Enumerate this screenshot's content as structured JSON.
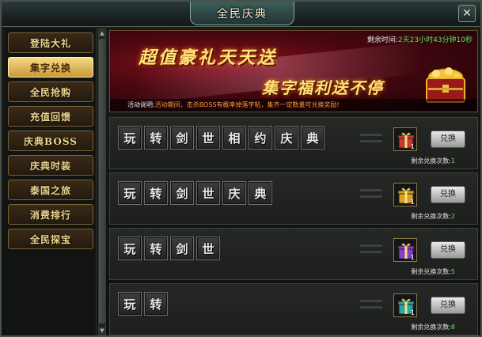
{
  "window": {
    "title": "全民庆典",
    "close_label": "✕"
  },
  "sidebar": {
    "items": [
      {
        "label": "登陆大礼",
        "active": false
      },
      {
        "label": "集字兑换",
        "active": true
      },
      {
        "label": "全民抢购",
        "active": false
      },
      {
        "label": "充值回馈",
        "active": false
      },
      {
        "label": "庆典BOSS",
        "active": false
      },
      {
        "label": "庆典时装",
        "active": false
      },
      {
        "label": "泰国之旅",
        "active": false
      },
      {
        "label": "消费排行",
        "active": false
      },
      {
        "label": "全民探宝",
        "active": false
      }
    ]
  },
  "banner": {
    "headline": "超值豪礼天天送",
    "subheadline": "集字福利送不停",
    "timer_label": "剩余时间:",
    "timer_value": "2天23小时43分钟10秒",
    "desc_label": "活动说明:",
    "desc_text": "活动期间，击杀BOSS有概率掉落字帖，集齐一定数量可兑换奖励!"
  },
  "rows": [
    {
      "chars": [
        "玩",
        "转",
        "剑",
        "世",
        "相",
        "约",
        "庆",
        "典"
      ],
      "reward_count": "1",
      "reward_color": "#c63a2a",
      "button": "兑换",
      "remain_label": "剩余兑换次数:",
      "remain": "1"
    },
    {
      "chars": [
        "玩",
        "转",
        "剑",
        "世",
        "庆",
        "典"
      ],
      "reward_count": "1",
      "reward_color": "#d8a11e",
      "button": "兑换",
      "remain_label": "剩余兑换次数:",
      "remain": "2"
    },
    {
      "chars": [
        "玩",
        "转",
        "剑",
        "世"
      ],
      "reward_count": "1",
      "reward_color": "#8a3cc8",
      "button": "兑换",
      "remain_label": "剩余兑换次数:",
      "remain": "5"
    },
    {
      "chars": [
        "玩",
        "转"
      ],
      "reward_count": "1",
      "reward_color": "#2aa6a6",
      "button": "兑换",
      "remain_label": "剩余兑换次数:",
      "remain": "8"
    }
  ]
}
